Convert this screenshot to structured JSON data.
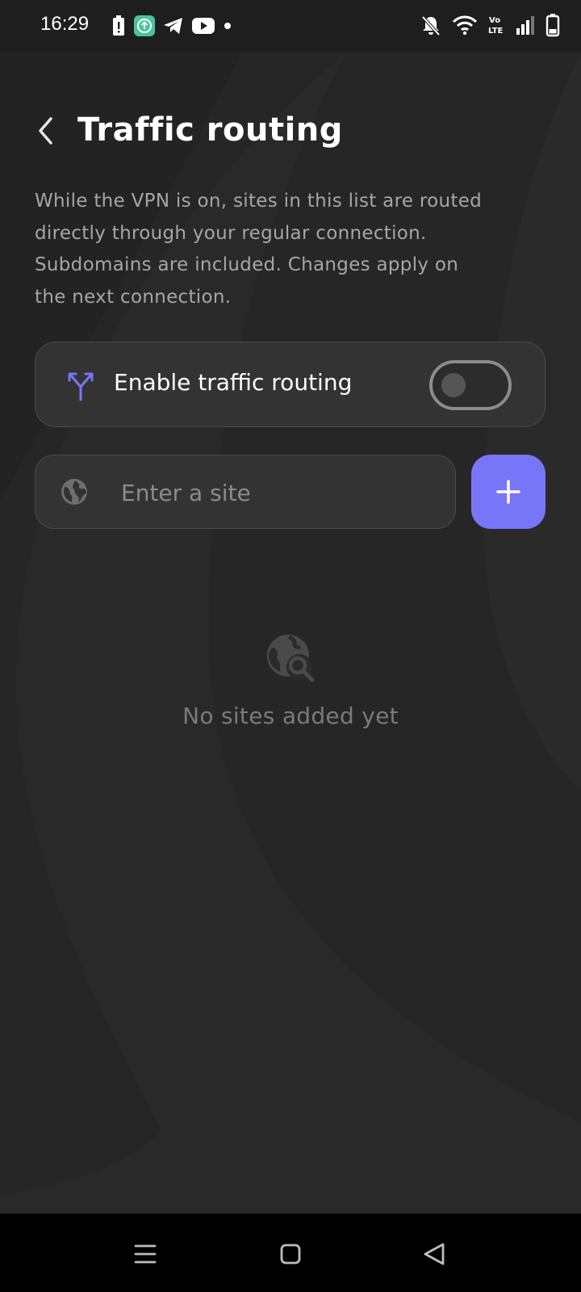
{
  "status_bar": {
    "time": "16:29",
    "left_icons": [
      "battery-alert-icon",
      "app-update-icon",
      "telegram-icon",
      "youtube-icon",
      "notification-dot-icon"
    ],
    "right_icons": [
      "bell-muted-icon",
      "wifi-icon",
      "volte-icon",
      "signal-icon",
      "battery-icon"
    ],
    "volte_label": "Vo\nLTE"
  },
  "header": {
    "back_icon": "chevron-left-icon",
    "title": "Traffic routing"
  },
  "description": "While the VPN is on, sites in this list are routed directly through your regular connection. Subdomains are included. Changes apply on the next connection.",
  "routing_toggle": {
    "icon": "split-routing-icon",
    "label": "Enable traffic routing",
    "enabled": false
  },
  "site_input": {
    "icon": "globe-icon",
    "placeholder": "Enter a site",
    "value": ""
  },
  "add_button": {
    "icon": "plus-icon"
  },
  "empty_state": {
    "icon": "globe-search-icon",
    "text": "No sites added yet"
  },
  "nav_bar": {
    "buttons": [
      "menu-icon",
      "home-square-icon",
      "back-triangle-icon"
    ]
  },
  "colors": {
    "background": "#262626",
    "card": "#333333",
    "accent": "#7876f8",
    "text_primary": "#ffffff",
    "text_secondary": "#a6a6a6",
    "text_muted": "#7a7a7a"
  }
}
